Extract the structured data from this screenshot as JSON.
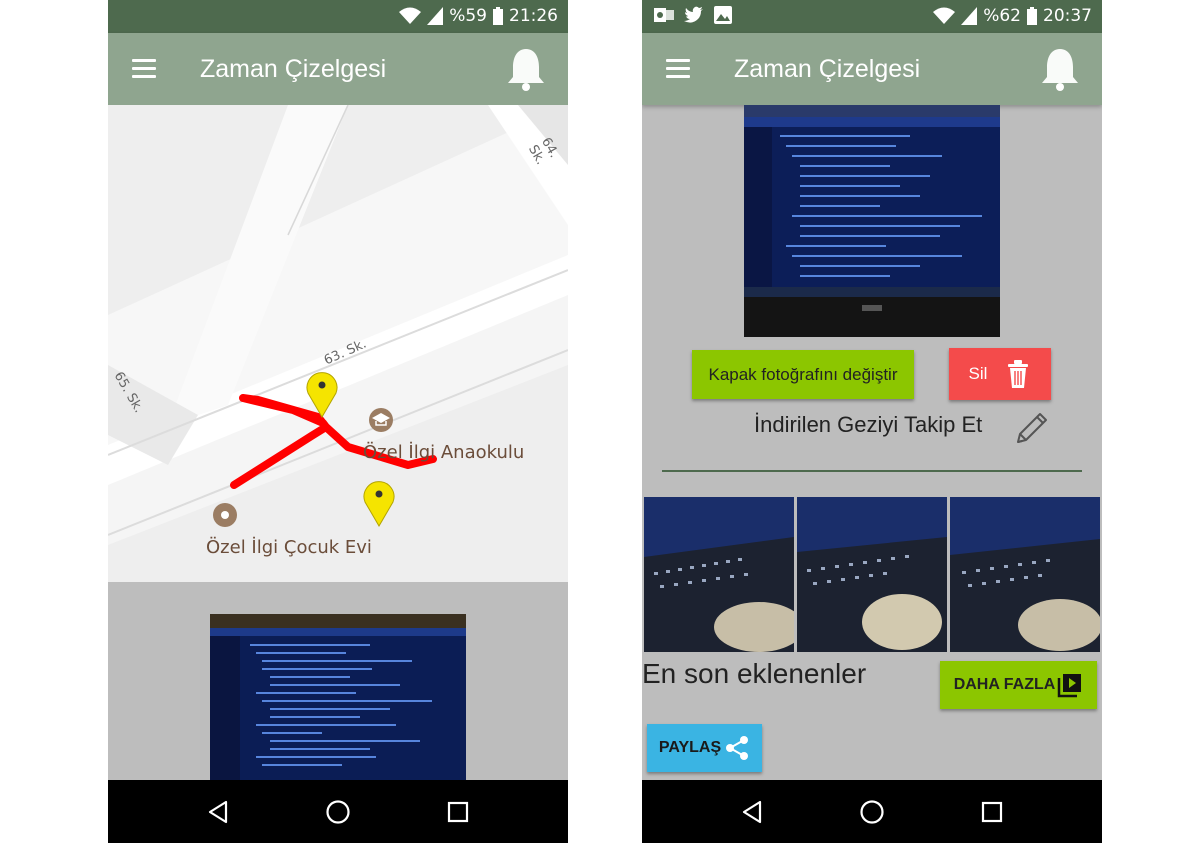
{
  "left": {
    "status": {
      "battery": "%59",
      "time": "21:26"
    },
    "appbar": {
      "title": "Zaman Çizelgesi"
    },
    "map": {
      "streets": [
        "63. Sk.",
        "64. Sk.",
        "65. Sk."
      ],
      "places": [
        "Özel İlgi Anaokulu",
        "Özel İlgi Çocuk Evi"
      ]
    }
  },
  "right": {
    "status": {
      "battery": "%62",
      "time": "20:37"
    },
    "appbar": {
      "title": "Zaman Çizelgesi"
    },
    "buttons": {
      "change_cover": "Kapak fotoğrafını değiştir",
      "delete": "Sil",
      "more": "DAHA FAZLA",
      "share": "PAYLAŞ"
    },
    "follow_label": "İndirilen Geziyi Takip Et",
    "recent_label": "En son eklenenler"
  },
  "colors": {
    "status_bar": "#4e6a4e",
    "app_bar": "#8fa58f",
    "accent_green": "#8cc600",
    "delete_red": "#f44b4b",
    "share_blue": "#3ab4e3",
    "route": "#ff0000"
  },
  "icons": [
    "menu-icon",
    "bell-icon",
    "wifi-icon",
    "signal-icon",
    "battery-icon",
    "outlook-icon",
    "twitter-icon",
    "gallery-icon",
    "trash-icon",
    "pencil-icon",
    "play-library-icon",
    "share-icon",
    "back-icon",
    "home-icon",
    "recents-icon",
    "map-marker-icon",
    "school-icon"
  ]
}
